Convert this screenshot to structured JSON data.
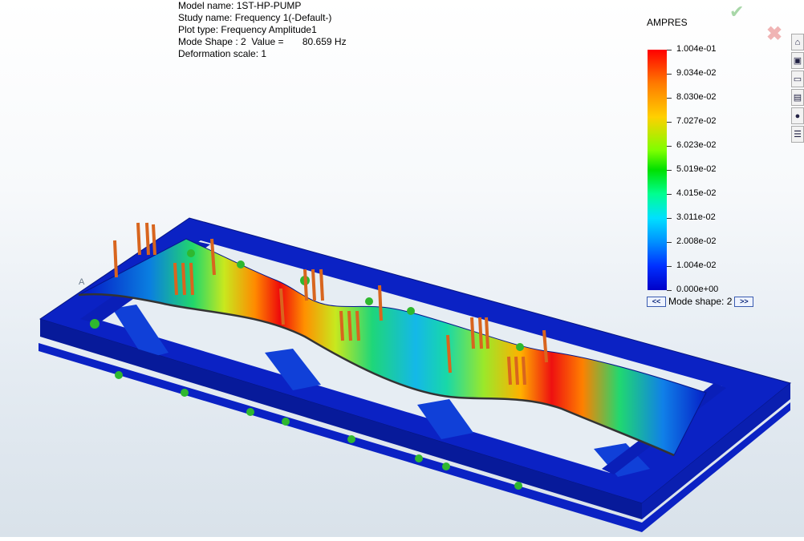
{
  "info": {
    "model_name": "Model name: 1ST-HP-PUMP",
    "study_name": "Study name: Frequency 1(-Default-)",
    "plot_type": "Plot type: Frequency Amplitude1",
    "mode_value": "Mode Shape : 2  Value =       80.659 Hz",
    "deformation": "Deformation scale: 1"
  },
  "legend": {
    "title": "AMPRES",
    "ticks": [
      "1.004e-01",
      "9.034e-02",
      "8.030e-02",
      "7.027e-02",
      "6.023e-02",
      "5.019e-02",
      "4.015e-02",
      "3.011e-02",
      "2.008e-02",
      "1.004e-02",
      "0.000e+00"
    ],
    "mode_shape_label": "Mode shape: 2",
    "prev_label": "<<",
    "next_label": ">>"
  },
  "side_toolbar": {
    "icons": [
      "home-icon",
      "cube-view-icon",
      "folder-icon",
      "plot-icon",
      "appearance-icon",
      "table-icon"
    ]
  },
  "viewport": {
    "point_label": "A"
  },
  "colors": {
    "frame_blue": "#0a1fb8",
    "max_red": "#ff0000",
    "fixture_green": "#2fb82f",
    "load_orange": "#d8651e"
  }
}
